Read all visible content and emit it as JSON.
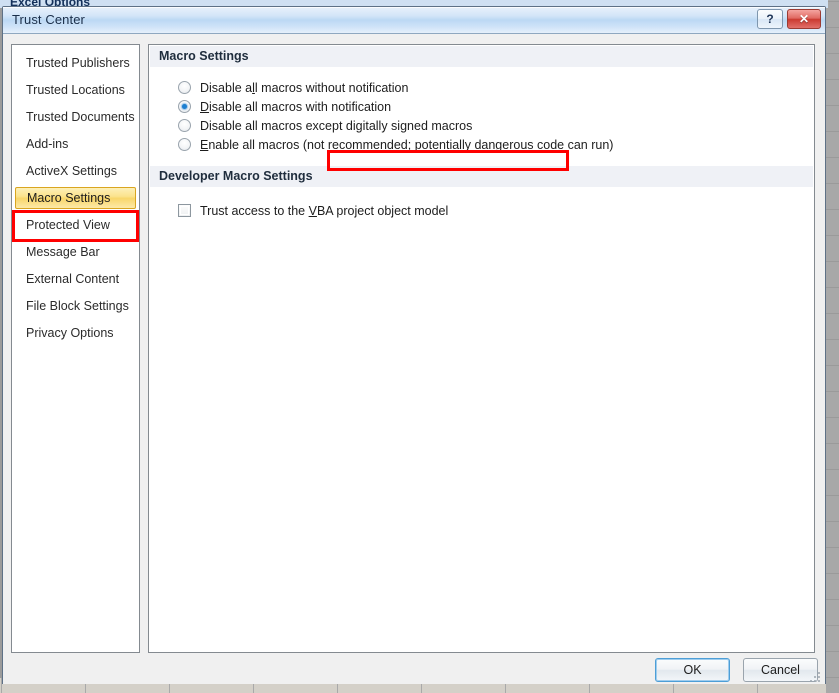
{
  "background": {
    "underlying_dialog_title": "Excel Options"
  },
  "window": {
    "title": "Trust Center",
    "help_label": "?",
    "close_label": "✕"
  },
  "sidebar": {
    "items": [
      {
        "label": "Trusted Publishers",
        "selected": false
      },
      {
        "label": "Trusted Locations",
        "selected": false
      },
      {
        "label": "Trusted Documents",
        "selected": false
      },
      {
        "label": "Add-ins",
        "selected": false
      },
      {
        "label": "ActiveX Settings",
        "selected": false
      },
      {
        "label": "Macro Settings",
        "selected": true
      },
      {
        "label": "Protected View",
        "selected": false
      },
      {
        "label": "Message Bar",
        "selected": false
      },
      {
        "label": "External Content",
        "selected": false
      },
      {
        "label": "File Block Settings",
        "selected": false
      },
      {
        "label": "Privacy Options",
        "selected": false
      }
    ]
  },
  "main": {
    "macro_settings": {
      "header": "Macro Settings",
      "options": [
        {
          "pre": "Disable a",
          "key": "l",
          "post": "l macros without notification",
          "full": "Disable all macros without notification",
          "checked": false
        },
        {
          "pre": "",
          "key": "D",
          "post": "isable all macros with notification",
          "full": "Disable all macros with notification",
          "checked": true
        },
        {
          "pre": "Disable all macros except di",
          "key": "g",
          "post": "itally signed macros",
          "full": "Disable all macros except digitally signed macros",
          "checked": false
        },
        {
          "pre": "",
          "key": "E",
          "post": "nable all macros (not recommended; potentially dangerous code can run)",
          "full": "Enable all macros (not recommended; potentially dangerous code can run)",
          "checked": false
        }
      ]
    },
    "developer_macro_settings": {
      "header": "Developer Macro Settings",
      "checkbox": {
        "pre": "Trust access to the ",
        "key": "V",
        "post": "BA project object model",
        "full": "Trust access to the VBA project object model",
        "checked": false
      }
    }
  },
  "footer": {
    "ok_label": "OK",
    "cancel_label": "Cancel"
  },
  "annotations": {
    "color": "#ff0000",
    "targets": [
      "Macro Settings",
      "Disable all macros with notification"
    ]
  }
}
